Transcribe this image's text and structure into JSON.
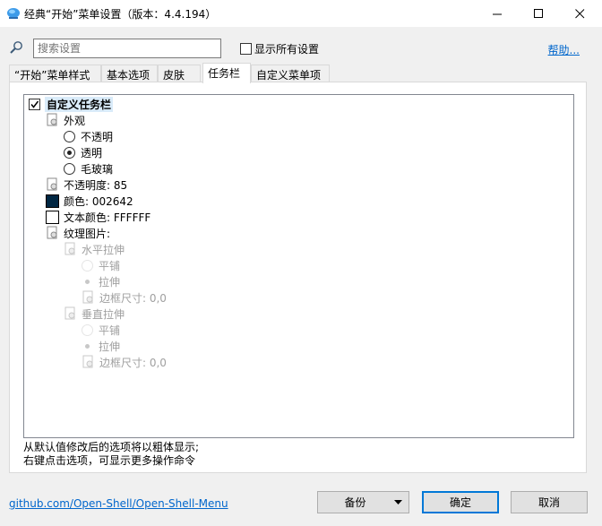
{
  "window": {
    "title": "经典“开始”菜单设置（版本：4.4.194）"
  },
  "search": {
    "placeholder": "搜索设置",
    "show_all_label": "显示所有设置",
    "help_label": "帮助..."
  },
  "tabs": [
    {
      "label": "“开始”菜单样式"
    },
    {
      "label": "基本选项"
    },
    {
      "label": "皮肤"
    },
    {
      "label": "任务栏"
    },
    {
      "label": "自定义菜单项"
    }
  ],
  "active_tab": "任务栏",
  "tree": {
    "root": {
      "label": "自定义任务栏",
      "checked": true
    },
    "appearance": {
      "label": "外观"
    },
    "opaque": {
      "label": "不透明"
    },
    "transparent": {
      "label": "透明",
      "selected": true
    },
    "glass": {
      "label": "毛玻璃"
    },
    "opacity": {
      "label": "不透明度: 85"
    },
    "color": {
      "label": "颜色: 002642",
      "swatch": "#002642"
    },
    "text_color": {
      "label": "文本颜色: FFFFFF",
      "swatch": "#FFFFFF"
    },
    "texture": {
      "label": "纹理图片:"
    },
    "h_stretch": {
      "label": "水平拉伸"
    },
    "h_tile": {
      "label": "平铺"
    },
    "h_stretch_opt": {
      "label": "拉伸",
      "selected": true
    },
    "h_border": {
      "label": "边框尺寸: 0,0"
    },
    "v_stretch": {
      "label": "垂直拉伸"
    },
    "v_tile": {
      "label": "平铺"
    },
    "v_stretch_opt": {
      "label": "拉伸",
      "selected": true
    },
    "v_border": {
      "label": "边框尺寸: 0,0"
    }
  },
  "notes": {
    "line1": "从默认值修改后的选项将以粗体显示;",
    "line2": "右键点击选项，可显示更多操作命令"
  },
  "footer": {
    "link": "github.com/Open-Shell/Open-Shell-Menu",
    "backup": "备份",
    "ok": "确定",
    "cancel": "取消"
  },
  "colors": {
    "link": "#0066cc",
    "accent": "#0078d7",
    "selection": "#d9ebf9",
    "disabled_text": "#a0a0a0"
  }
}
